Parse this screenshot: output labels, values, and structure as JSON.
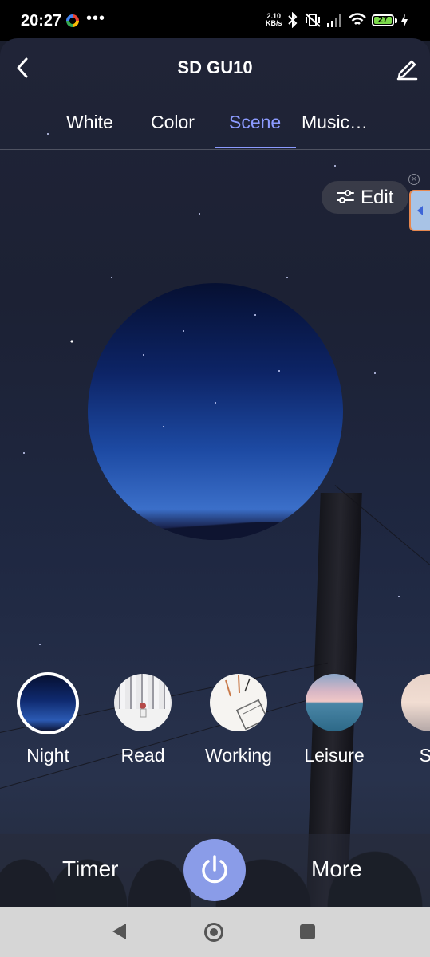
{
  "status_bar": {
    "time": "20:27",
    "network_speed_value": "2.10",
    "network_speed_unit": "KB/s",
    "battery_level": "27",
    "more_indicator": "•••"
  },
  "header": {
    "title": "SD GU10"
  },
  "tabs": [
    {
      "label": "White",
      "active": false
    },
    {
      "label": "Color",
      "active": false
    },
    {
      "label": "Scene",
      "active": true
    },
    {
      "label": "Music…",
      "active": false
    }
  ],
  "edit_button": {
    "label": "Edit"
  },
  "scenes": [
    {
      "label": "Night",
      "selected": true
    },
    {
      "label": "Read",
      "selected": false
    },
    {
      "label": "Working",
      "selected": false
    },
    {
      "label": "Leisure",
      "selected": false
    },
    {
      "label": "Sc",
      "selected": false
    }
  ],
  "bottom_bar": {
    "timer_label": "Timer",
    "more_label": "More"
  },
  "colors": {
    "accent": "#8c9bff",
    "power_button": "#8a9ce8"
  },
  "icons": {
    "back": "chevron-left-icon",
    "edit_device": "pencil-icon",
    "edit_scene": "sliders-icon",
    "power": "power-icon"
  }
}
